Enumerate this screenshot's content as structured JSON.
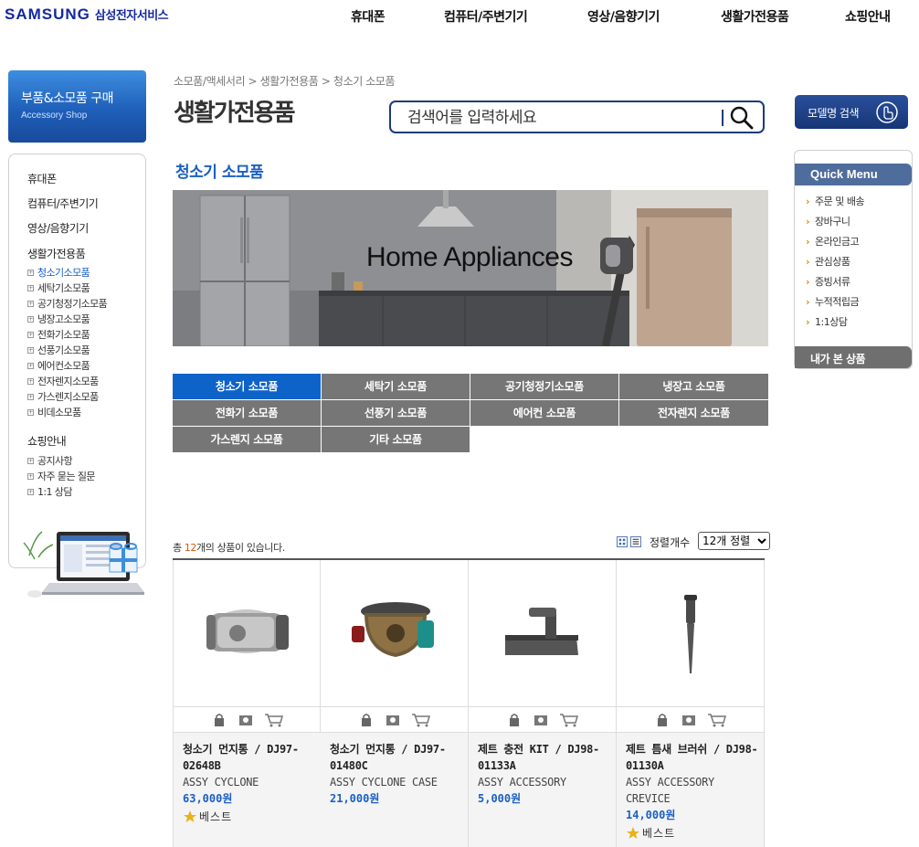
{
  "header": {
    "logo_brand": "SAMSUNG",
    "logo_service": "삼성전자서비스",
    "nav": [
      "휴대폰",
      "컴퓨터/주변기기",
      "영상/음향기기",
      "생활가전용품",
      "쇼핑안내"
    ]
  },
  "sidebar": {
    "banner_title": "부품&소모품 구매",
    "banner_subtitle": "Accessory Shop",
    "categories": {
      "phone": "휴대폰",
      "computer": "컴퓨터/주변기기",
      "av": "영상/음향기기",
      "home": "생활가전용품",
      "shop": "쇼핑안내"
    },
    "home_items": [
      "청소기소모품",
      "세탁기소모품",
      "공기청정기소모품",
      "냉장고소모품",
      "전화기소모품",
      "선풍기소모품",
      "에어컨소모품",
      "전자렌지소모품",
      "가스렌지소모품",
      "비데소모품"
    ],
    "shop_items": [
      "공지사항",
      "자주 묻는 질문",
      "1:1 상담"
    ]
  },
  "breadcrumb": "소모품/액세서리 > 생활가전용품 > 청소기 소모품",
  "page_title": "생활가전용품",
  "search": {
    "placeholder": "검색어를 입력하세요"
  },
  "section_title": "청소기 소모품",
  "banner_text": "Home Appliances",
  "tabs": [
    "청소기 소모품",
    "세탁기 소모품",
    "공기청정기소모품",
    "냉장고 소모품",
    "전화기 소모품",
    "선풍기 소모품",
    "에어컨 소모품",
    "전자렌지 소모품",
    "가스렌지 소모품",
    "기타 소모품"
  ],
  "list": {
    "count_prefix": "총 ",
    "count": "12",
    "count_suffix": "개의 상품이 있습니다.",
    "sort_label": "정렬개수",
    "sort_value": "12개 정렬"
  },
  "products": [
    {
      "name": "청소기 먼지통 / DJ97-02648B",
      "model": "ASSY CYCLONE",
      "price": "63,000원",
      "badge": "베스트"
    },
    {
      "name": "청소기 먼지통 / DJ97-01480C",
      "model": "ASSY CYCLONE CASE",
      "price": "21,000원",
      "badge": ""
    },
    {
      "name": "제트 충전 KIT / DJ98-01133A",
      "model": "ASSY ACCESSORY",
      "price": "5,000원",
      "badge": ""
    },
    {
      "name": "제트 틈새 브러쉬 / DJ98-01130A",
      "model": "ASSY ACCESSORY CREVICE",
      "price": "14,000원",
      "badge": "베스트"
    }
  ],
  "right": {
    "model_search": "모델명 검색",
    "quick_title": "Quick Menu",
    "quick_items": [
      "주문 및 배송",
      "장바구니",
      "온라인금고",
      "관심상품",
      "증빙서류",
      "누적적립금",
      "1:1상담"
    ],
    "recent": "내가 본 상품"
  },
  "colors": {
    "brand": "#1428a0",
    "accent_blue": "#1a5fc4",
    "active_tab": "#0e63c9",
    "tab": "#767676"
  }
}
